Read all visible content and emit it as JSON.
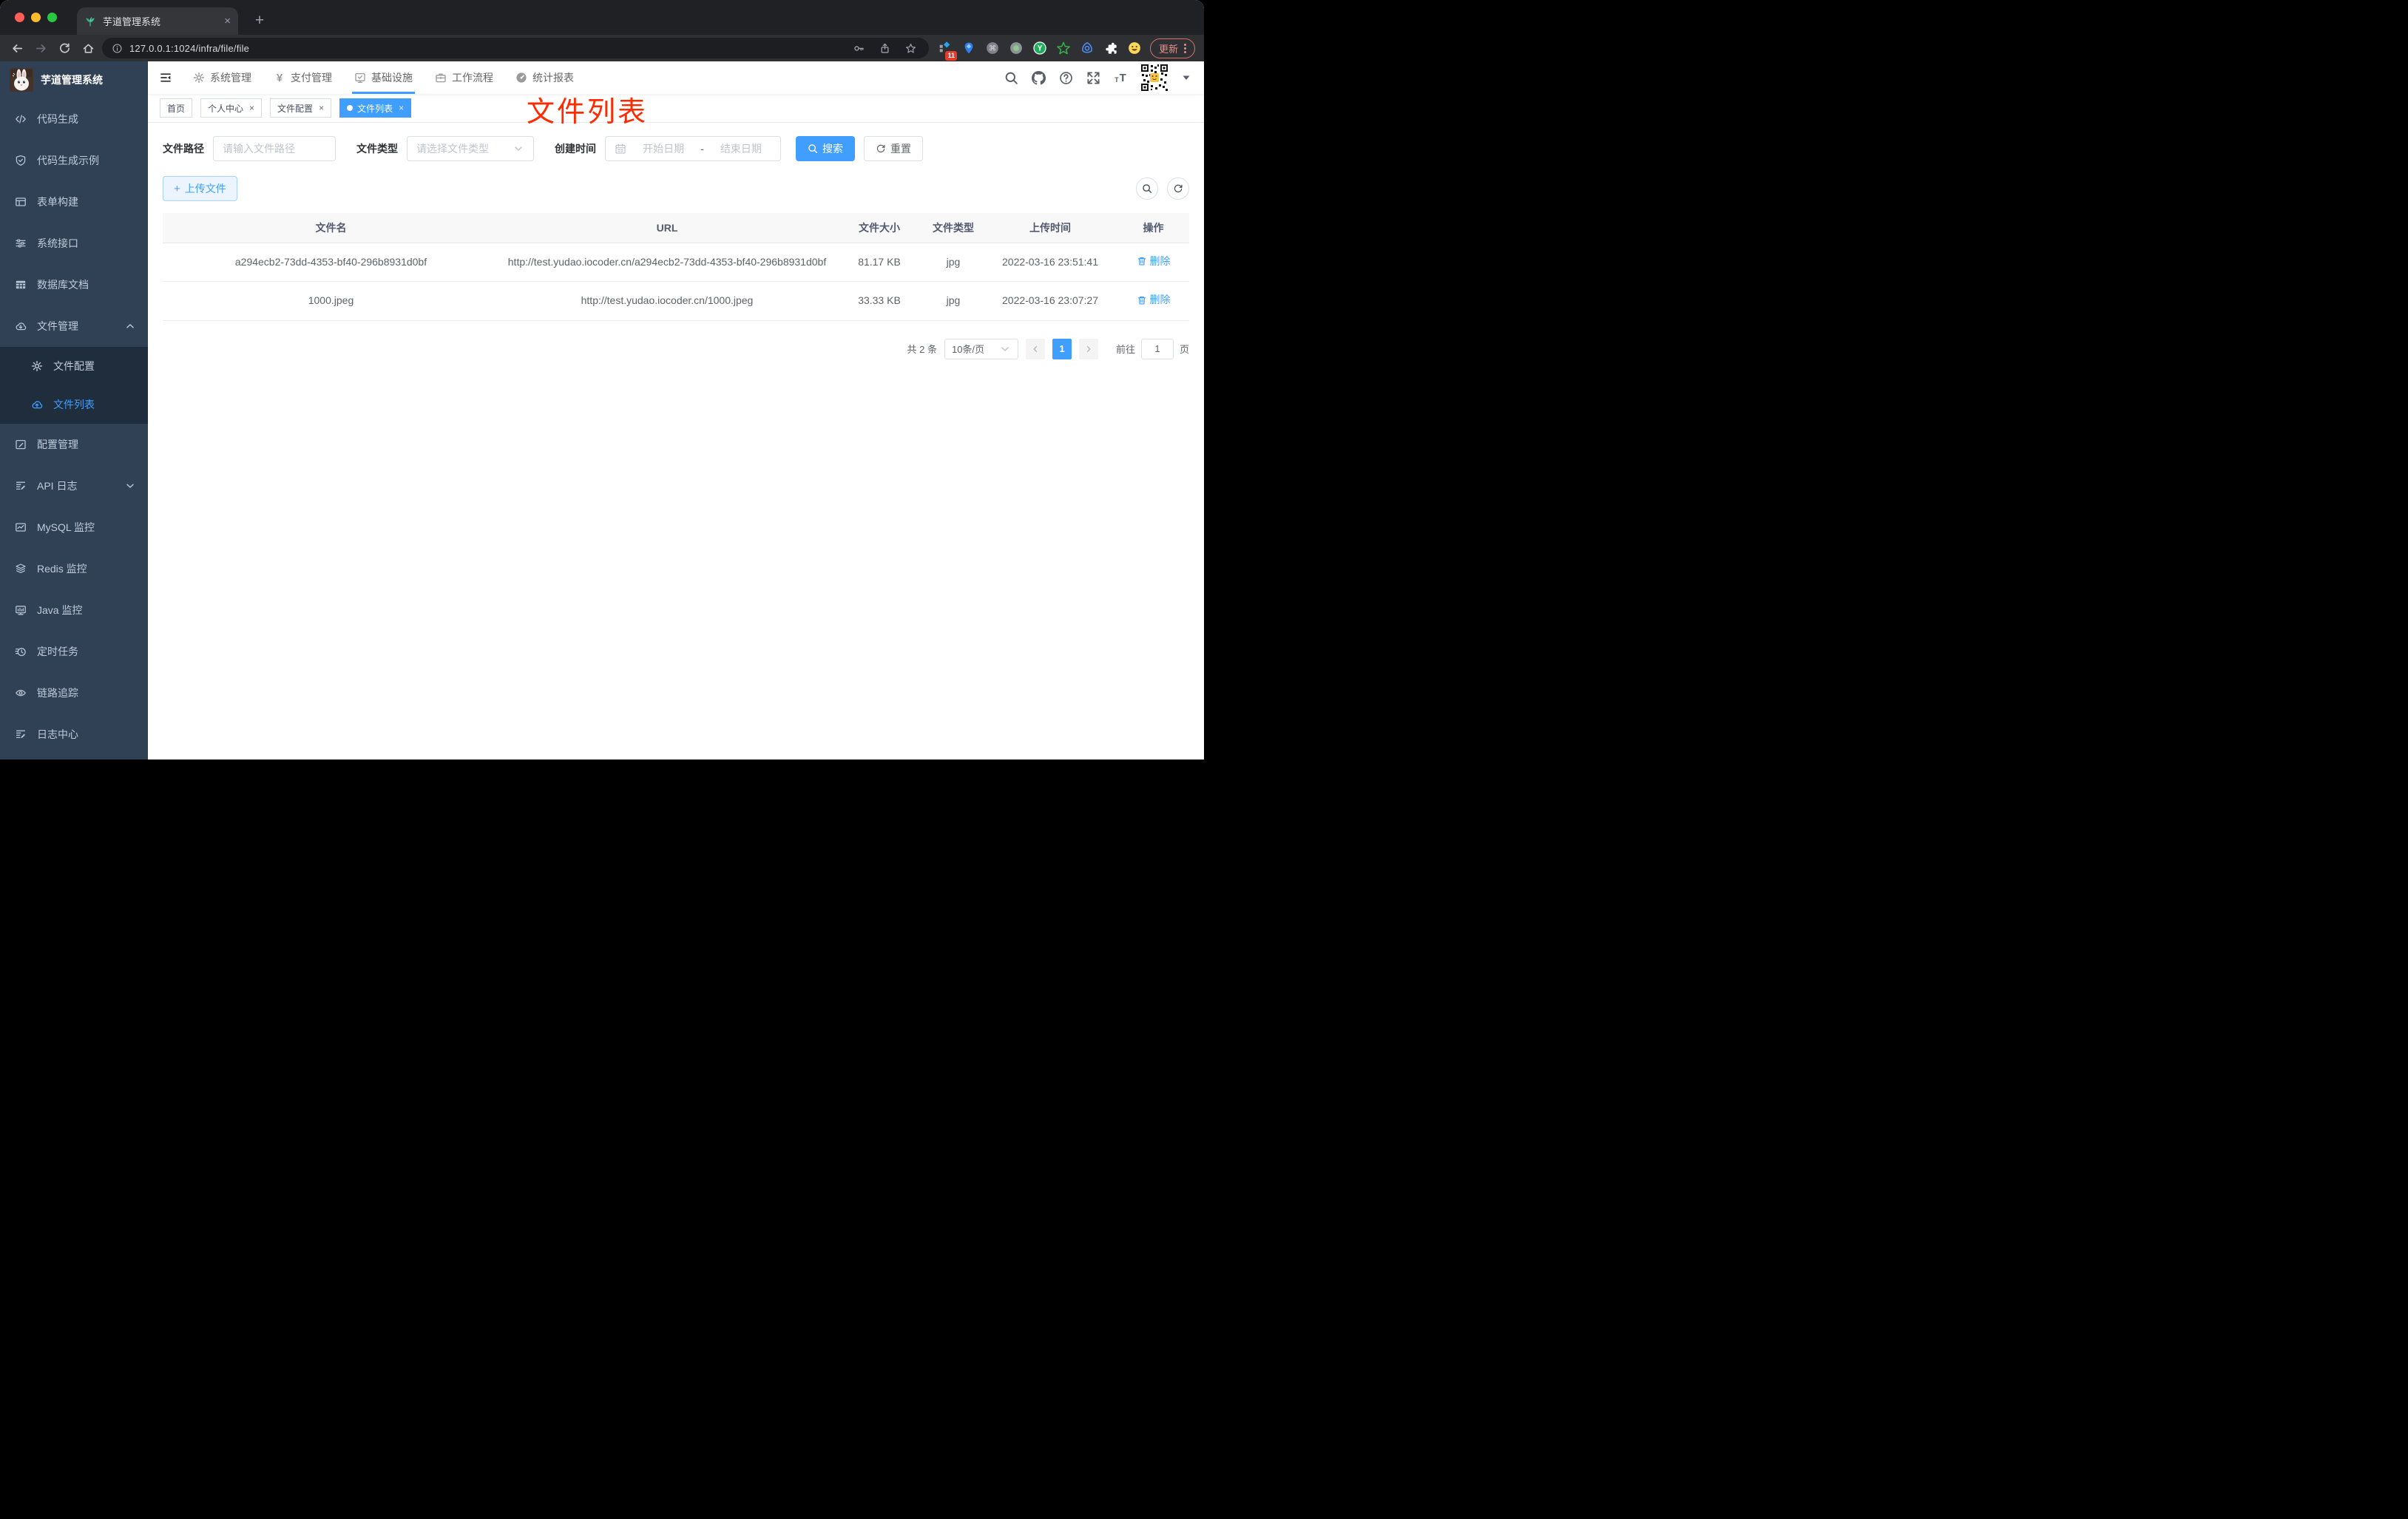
{
  "browser": {
    "tab": {
      "title": "芋道管理系统",
      "favicon": "sprout-favicon-icon",
      "close_glyph": "×",
      "new_tab_glyph": "+"
    },
    "toolbar": {
      "url": "127.0.0.1:1024/infra/file/file",
      "update_label": "更新",
      "nav_icons": [
        {
          "icon": "back-arrow-icon",
          "dim": false
        },
        {
          "icon": "forward-arrow-icon",
          "dim": true
        },
        {
          "icon": "reload-icon",
          "dim": false
        },
        {
          "icon": "home-icon",
          "dim": false
        }
      ],
      "pill_icons": [
        {
          "icon": "key-icon"
        },
        {
          "icon": "share-icon"
        },
        {
          "icon": "star-icon"
        }
      ],
      "extensions": [
        {
          "icon": "ext-grid-diamond-icon",
          "badge": "11"
        },
        {
          "icon": "ext-pin-icon"
        },
        {
          "icon": "ext-command-icon"
        },
        {
          "icon": "ext-dot-icon"
        },
        {
          "icon": "ext-y-icon"
        },
        {
          "icon": "ext-star-icon"
        },
        {
          "icon": "ext-eye-icon"
        },
        {
          "icon": "ext-puzzle-icon"
        },
        {
          "icon": "ext-emoji-icon"
        }
      ]
    }
  },
  "app": {
    "close_glyph": "×",
    "header": {
      "menus": [
        {
          "label": "系统管理",
          "icon": "gear-icon",
          "active": false
        },
        {
          "label": "支付管理",
          "icon": "yen-icon",
          "active": false
        },
        {
          "label": "基础设施",
          "icon": "infra-icon",
          "active": true
        },
        {
          "label": "工作流程",
          "icon": "briefcase-icon",
          "active": false
        },
        {
          "label": "统计报表",
          "icon": "gauge-icon",
          "active": false
        }
      ],
      "right_icons": [
        {
          "icon": "search-icon"
        },
        {
          "icon": "github-icon"
        },
        {
          "icon": "help-icon"
        },
        {
          "icon": "fullscreen-icon"
        },
        {
          "icon": "fontsize-icon"
        }
      ]
    },
    "sidebar": {
      "title": "芋道管理系统",
      "items_top": [
        {
          "label": "代码生成",
          "icon": "code-icon"
        },
        {
          "label": "代码生成示例",
          "icon": "shield-check-icon"
        },
        {
          "label": "表单构建",
          "icon": "form-icon"
        },
        {
          "label": "系统接口",
          "icon": "sliders-icon"
        },
        {
          "label": "数据库文档",
          "icon": "db-grid-icon"
        },
        {
          "label": "文件管理",
          "icon": "cloud-down-icon",
          "expanded": true
        }
      ],
      "submenu": [
        {
          "label": "文件配置",
          "icon": "gear-outline-icon",
          "active": false
        },
        {
          "label": "文件列表",
          "icon": "cloud-up-icon",
          "active": true
        }
      ],
      "items_bottom": [
        {
          "label": "配置管理",
          "icon": "edit-square-icon"
        },
        {
          "label": "API 日志",
          "icon": "doc-edit-icon",
          "arrow": "down"
        },
        {
          "label": "MySQL 监控",
          "icon": "chart-line-icon"
        },
        {
          "label": "Redis 监控",
          "icon": "layers-icon"
        },
        {
          "label": "Java 监控",
          "icon": "monitor-icon"
        },
        {
          "label": "定时任务",
          "icon": "timer-icon"
        },
        {
          "label": "链路追踪",
          "icon": "eye-icon"
        },
        {
          "label": "日志中心",
          "icon": "log-edit-icon"
        }
      ]
    },
    "tags": [
      {
        "label": "首页",
        "closable": false,
        "active": false
      },
      {
        "label": "个人中心",
        "closable": true,
        "active": false
      },
      {
        "label": "文件配置",
        "closable": true,
        "active": false
      },
      {
        "label": "文件列表",
        "closable": true,
        "active": true
      }
    ],
    "annotation": {
      "text": "文件列表",
      "color": "#ff2a00"
    },
    "filters": {
      "path_label": "文件路径",
      "path_placeholder": "请输入文件路径",
      "type_label": "文件类型",
      "type_placeholder": "请选择文件类型",
      "time_label": "创建时间",
      "start_placeholder": "开始日期",
      "separator": "-",
      "end_placeholder": "结束日期",
      "search_label": "搜索",
      "reset_label": "重置"
    },
    "actions": {
      "upload_label": "上传文件",
      "plus_glyph": "+"
    },
    "table": {
      "columns": [
        "文件名",
        "URL",
        "文件大小",
        "文件类型",
        "上传时间",
        "操作"
      ],
      "rows": [
        {
          "name": "a294ecb2-73dd-4353-bf40-296b8931d0bf",
          "url": "http://test.yudao.iocoder.cn/a294ecb2-73dd-4353-bf40-296b8931d0bf",
          "size": "81.17 KB",
          "type": "jpg",
          "time": "2022-03-16 23:51:41",
          "action": "删除"
        },
        {
          "name": "1000.jpeg",
          "url": "http://test.yudao.iocoder.cn/1000.jpeg",
          "size": "33.33 KB",
          "type": "jpg",
          "time": "2022-03-16 23:07:27",
          "action": "删除"
        }
      ]
    },
    "pagination": {
      "total": "共 2 条",
      "page_size": "10条/页",
      "page": "1",
      "goto_label": "前往",
      "goto_value": "1",
      "unit_label": "页"
    },
    "colors": {
      "accent": "#409eff",
      "sidebar_bg": "#304156",
      "submenu_bg": "#1f2d3d",
      "tag_active": "#409eff",
      "annotation": "#ff2a00"
    }
  }
}
